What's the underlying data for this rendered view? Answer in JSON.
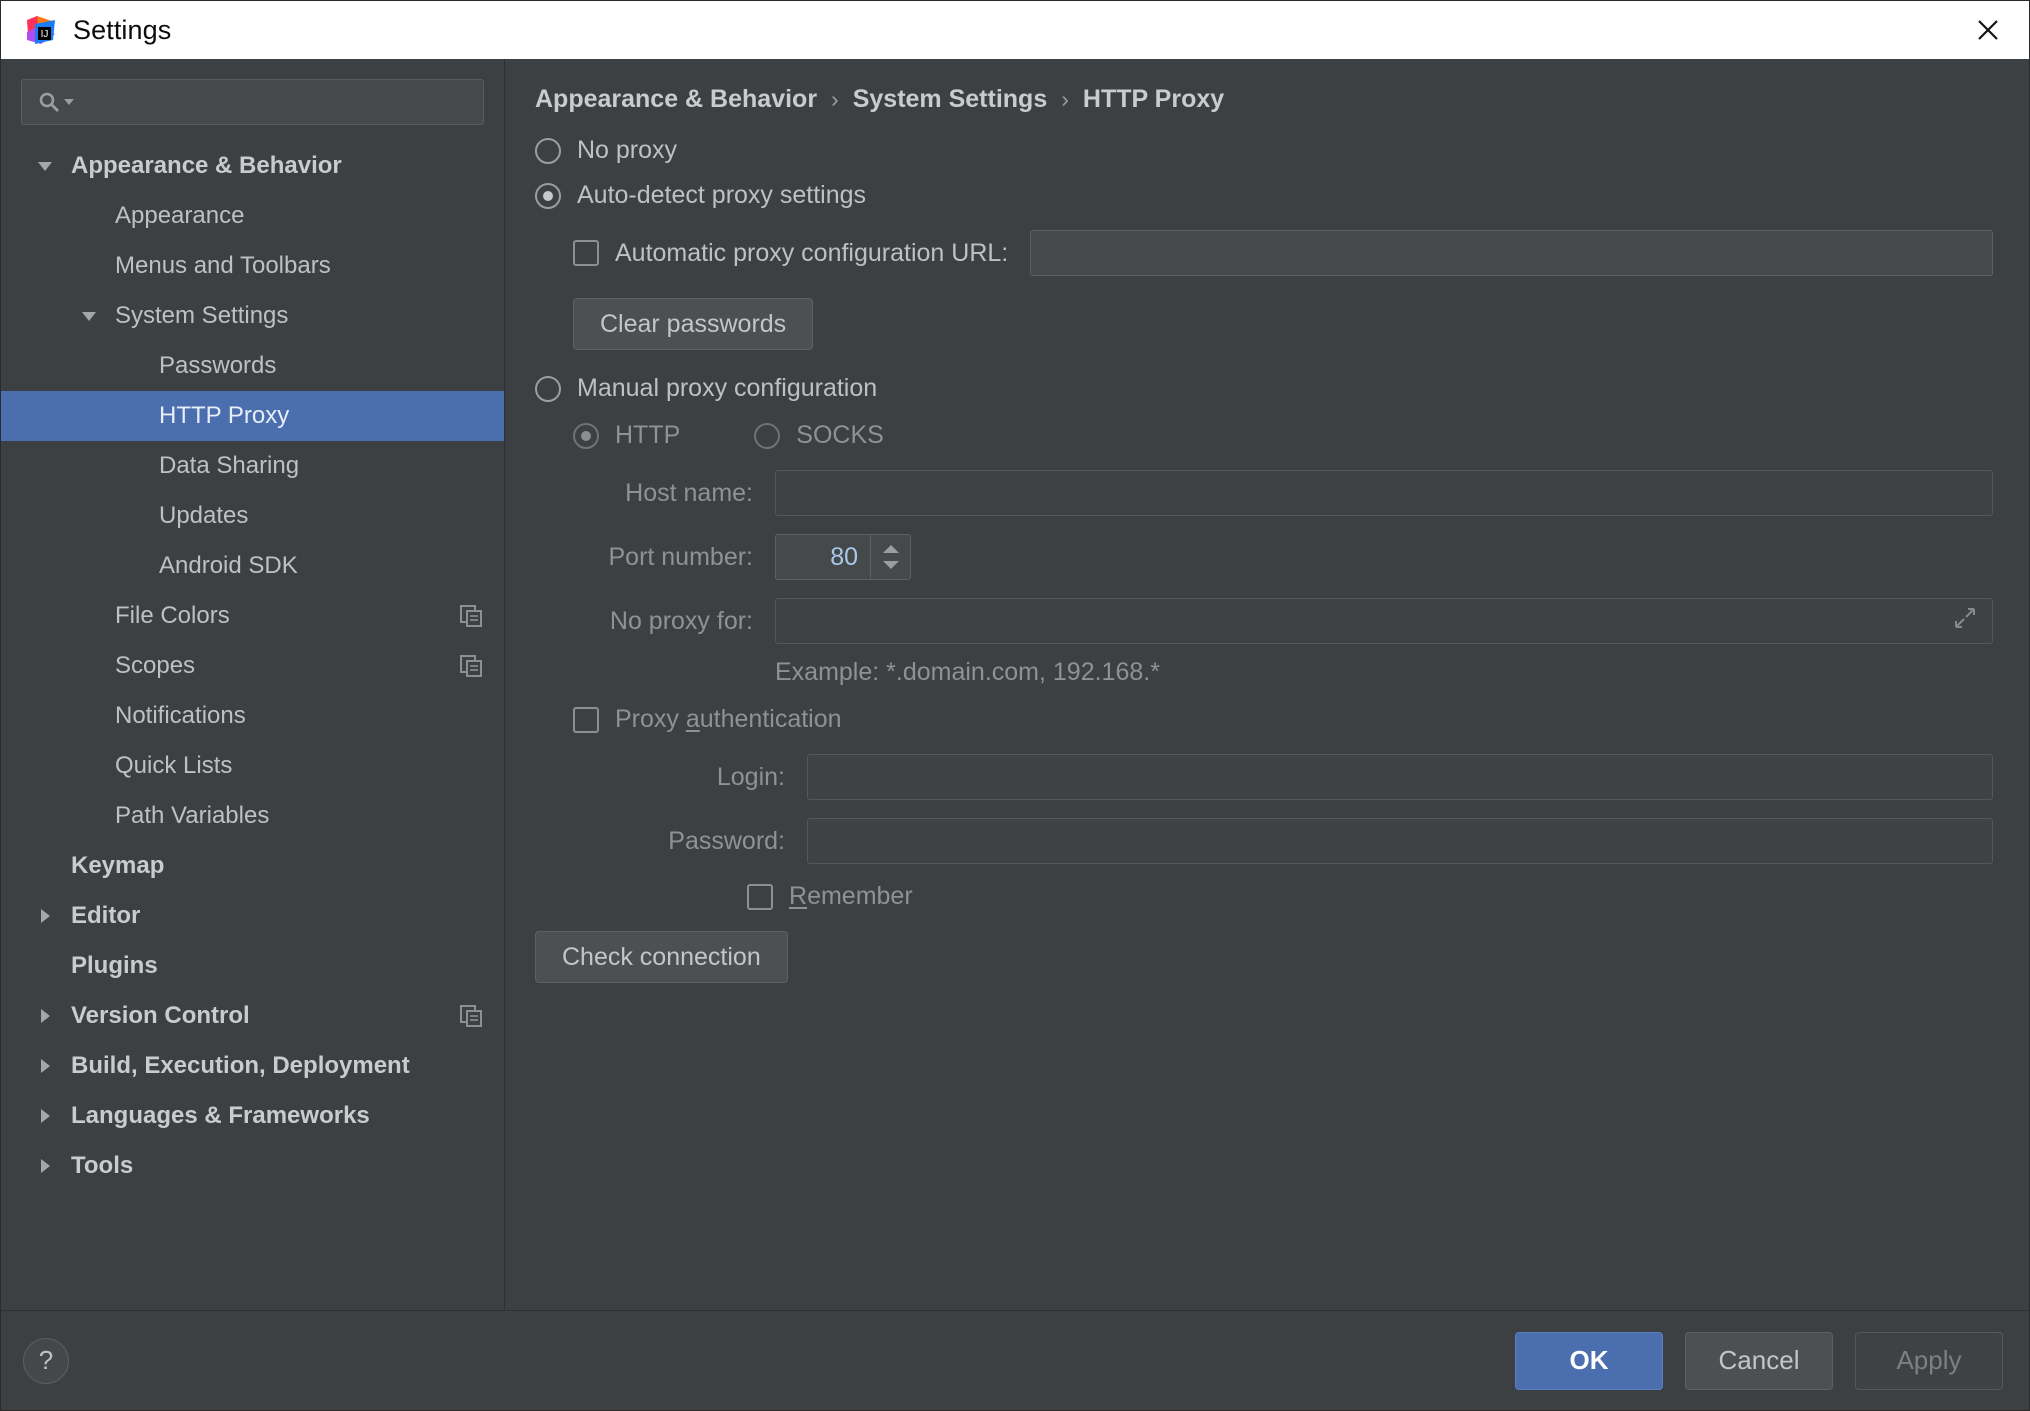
{
  "window": {
    "title": "Settings",
    "logo_icon": "intellij-idea-logo",
    "close_icon": "close-icon"
  },
  "sidebar": {
    "search": {
      "value": "",
      "placeholder": "",
      "icon": "search-icon",
      "dropdown_icon": "chevron-down-icon"
    },
    "items": [
      {
        "label": "Appearance & Behavior",
        "depth": 0,
        "bold": true,
        "arrow": "expanded",
        "selected": false,
        "icon": null
      },
      {
        "label": "Appearance",
        "depth": 1,
        "bold": false,
        "arrow": "none",
        "selected": false,
        "icon": null
      },
      {
        "label": "Menus and Toolbars",
        "depth": 1,
        "bold": false,
        "arrow": "none",
        "selected": false,
        "icon": null
      },
      {
        "label": "System Settings",
        "depth": 1,
        "bold": false,
        "arrow": "expanded",
        "selected": false,
        "icon": null
      },
      {
        "label": "Passwords",
        "depth": 2,
        "bold": false,
        "arrow": "none",
        "selected": false,
        "icon": null
      },
      {
        "label": "HTTP Proxy",
        "depth": 2,
        "bold": false,
        "arrow": "none",
        "selected": true,
        "icon": null
      },
      {
        "label": "Data Sharing",
        "depth": 2,
        "bold": false,
        "arrow": "none",
        "selected": false,
        "icon": null
      },
      {
        "label": "Updates",
        "depth": 2,
        "bold": false,
        "arrow": "none",
        "selected": false,
        "icon": null
      },
      {
        "label": "Android SDK",
        "depth": 2,
        "bold": false,
        "arrow": "none",
        "selected": false,
        "icon": null
      },
      {
        "label": "File Colors",
        "depth": 1,
        "bold": false,
        "arrow": "none",
        "selected": false,
        "icon": "copy-icon"
      },
      {
        "label": "Scopes",
        "depth": 1,
        "bold": false,
        "arrow": "none",
        "selected": false,
        "icon": "copy-icon"
      },
      {
        "label": "Notifications",
        "depth": 1,
        "bold": false,
        "arrow": "none",
        "selected": false,
        "icon": null
      },
      {
        "label": "Quick Lists",
        "depth": 1,
        "bold": false,
        "arrow": "none",
        "selected": false,
        "icon": null
      },
      {
        "label": "Path Variables",
        "depth": 1,
        "bold": false,
        "arrow": "none",
        "selected": false,
        "icon": null
      },
      {
        "label": "Keymap",
        "depth": 0,
        "bold": true,
        "arrow": "none",
        "selected": false,
        "icon": null
      },
      {
        "label": "Editor",
        "depth": 0,
        "bold": true,
        "arrow": "collapsed",
        "selected": false,
        "icon": null
      },
      {
        "label": "Plugins",
        "depth": 0,
        "bold": true,
        "arrow": "none",
        "selected": false,
        "icon": null
      },
      {
        "label": "Version Control",
        "depth": 0,
        "bold": true,
        "arrow": "collapsed",
        "selected": false,
        "icon": "copy-icon"
      },
      {
        "label": "Build, Execution, Deployment",
        "depth": 0,
        "bold": true,
        "arrow": "collapsed",
        "selected": false,
        "icon": null
      },
      {
        "label": "Languages & Frameworks",
        "depth": 0,
        "bold": true,
        "arrow": "collapsed",
        "selected": false,
        "icon": null
      },
      {
        "label": "Tools",
        "depth": 0,
        "bold": true,
        "arrow": "collapsed",
        "selected": false,
        "icon": null
      }
    ]
  },
  "breadcrumb": {
    "separator": "›",
    "items": [
      "Appearance & Behavior",
      "System Settings",
      "HTTP Proxy"
    ]
  },
  "main": {
    "no_proxy": {
      "label": "No proxy",
      "checked": false
    },
    "auto_detect": {
      "label": "Auto-detect proxy settings",
      "checked": true
    },
    "auto_config_url": {
      "label": "Automatic proxy configuration URL:",
      "checked": false,
      "value": "",
      "placeholder": ""
    },
    "clear_passwords_button": "Clear passwords",
    "manual": {
      "label": "Manual proxy configuration",
      "checked": false
    },
    "protocol": {
      "http": {
        "label": "HTTP",
        "checked": true
      },
      "socks": {
        "label": "SOCKS",
        "checked": false
      }
    },
    "host_name": {
      "label": "Host name:",
      "value": "",
      "placeholder": ""
    },
    "port_number": {
      "label": "Port number:",
      "value": "80",
      "spinner_up_icon": "chevron-up-icon",
      "spinner_down_icon": "chevron-down-icon"
    },
    "no_proxy_for": {
      "label": "No proxy for:",
      "value": "",
      "placeholder": "",
      "expand_icon": "expand-icon"
    },
    "example_hint": "Example: *.domain.com, 192.168.*",
    "proxy_auth": {
      "label_before": "Proxy ",
      "mnemonic": "a",
      "label_after": "uthentication",
      "checked": false
    },
    "login": {
      "label": "Login:",
      "value": "",
      "placeholder": ""
    },
    "password": {
      "label": "Password:",
      "value": "",
      "placeholder": ""
    },
    "remember": {
      "mnemonic": "R",
      "label_after": "emember",
      "checked": false
    },
    "check_connection_button": "Check connection"
  },
  "footer": {
    "help_label": "?",
    "help_icon": "help-icon",
    "ok": "OK",
    "cancel": "Cancel",
    "apply": "Apply"
  },
  "colors": {
    "accent": "#4b6eaf",
    "background": "#3c4043",
    "titlebar": "#ffffff",
    "text": "#bec0c2",
    "port_value": "#a9c7e8"
  }
}
